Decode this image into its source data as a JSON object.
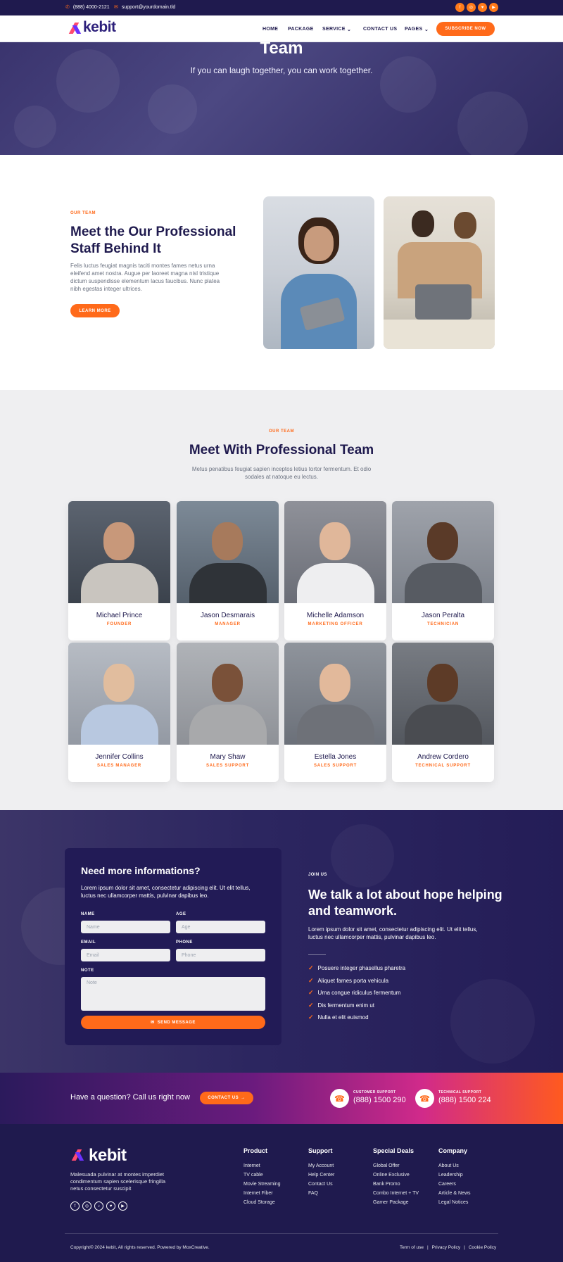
{
  "topbar": {
    "phone": "(888) 4000-2121",
    "email": "support@yourdomain.tld",
    "social": [
      "f",
      "◎",
      "♥",
      "▶"
    ]
  },
  "brand": {
    "name": "kebit",
    "accent": "#ff6a1a",
    "dark": "#1f1a4e"
  },
  "nav": {
    "items": [
      "HOME",
      "PACKAGE",
      "SERVICE",
      "CONTACT US",
      "PAGES"
    ],
    "cta": "SUBSCRIBE NOW"
  },
  "hero": {
    "title": "Team",
    "subtitle": "If you can laugh together, you can work together."
  },
  "meet": {
    "kicker": "OUR TEAM",
    "title_line1": "Meet the Our Professional",
    "title_line2": "Staff Behind It",
    "body": "Felis luctus feugiat magnis taciti montes fames netus urna eleifend amet nostra. Augue per laoreet magna nisl tristique dictum suspendisse elementum lacus faucibus. Nunc platea nibh egestas integer ultrices.",
    "button": "LEARN MORE"
  },
  "team": {
    "kicker": "OUR TEAM",
    "title": "Meet With Professional Team",
    "intro_line1": "Metus penatibus feugiat sapien inceptos letius tortor fermentum. Et odio",
    "intro_line2": "sodales at natoque eu lectus.",
    "members": [
      {
        "name": "Michael Prince",
        "role": "FOUNDER"
      },
      {
        "name": "Jason Desmarais",
        "role": "MANAGER"
      },
      {
        "name": "Michelle Adamson",
        "role": "MARKETING OFFICER"
      },
      {
        "name": "Jason Peralta",
        "role": "TECHNICIAN"
      },
      {
        "name": "Jennifer Collins",
        "role": "SALES MANAGER"
      },
      {
        "name": "Mary Shaw",
        "role": "SALES SUPPORT"
      },
      {
        "name": "Estella Jones",
        "role": "SALES SUPPORT"
      },
      {
        "name": "Andrew Cordero",
        "role": "TECHNICAL SUPPORT"
      }
    ]
  },
  "form": {
    "title": "Need more informations?",
    "intro_line1": "Lorem ipsum dolor sit amet, consectetur adipiscing elit. Ut elit tellus,",
    "intro_line2": "luctus nec ullamcorper mattis, pulvinar dapibus leo.",
    "name_label": "NAME",
    "name_placeholder": "Name",
    "age_label": "AGE",
    "age_placeholder": "Age",
    "email_label": "EMAIL",
    "email_placeholder": "Email",
    "phone_label": "PHONE",
    "phone_placeholder": "Phone",
    "note_label": "NOTE",
    "note_placeholder": "Note",
    "submit": "SEND MESSAGE"
  },
  "join": {
    "kicker": "JOIN US",
    "title_line1": "We talk a lot about hope helping",
    "title_line2": "and teamwork.",
    "body_line1": "Lorem ipsum dolor sit amet, consectetur adipiscing elit. Ut elit tellus,",
    "body_line2": "luctus nec ullamcorper mattis, pulvinar dapibus leo.",
    "list": [
      "Posuere integer phasellus pharetra",
      "Aliquet fames porta vehicula",
      "Urna congue ridiculus fermentum",
      "Dis fermentum enim ut",
      "Nulla et elit euismod"
    ]
  },
  "cta": {
    "question": "Have a question? Call us right now",
    "button": "CONTACT US",
    "customer_label": "CUSTOMER SUPPORT",
    "customer_phone": "(888) 1500 290",
    "tech_label": "TECHNICAL SUPPORT",
    "tech_phone": "(888) 1500 224"
  },
  "footer": {
    "about_line1": "Malesuada pulvinar at montes imperdiet",
    "about_line2": "condimentum sapien scelerisque fringilla",
    "about_line3": "netus consectetur suscipit",
    "social": [
      "f",
      "◎",
      "♪",
      "♥",
      "▶"
    ],
    "columns": [
      {
        "title": "Product",
        "links": [
          "Internet",
          "TV cable",
          "Movie Streaming",
          "Internet Fiber",
          "Cloud Storage"
        ]
      },
      {
        "title": "Support",
        "links": [
          "My Account",
          "Help Center",
          "Contact Us",
          "FAQ"
        ]
      },
      {
        "title": "Special Deals",
        "links": [
          "Global Offer",
          "Online Exclusive",
          "Bank Promo",
          "Combo Internet + TV",
          "Gamer Package"
        ]
      },
      {
        "title": "Company",
        "links": [
          "About Us",
          "Leadership",
          "Careers",
          "Article & News",
          "Legal Notices"
        ]
      }
    ],
    "copyright": "Copyright© 2024 kebit, All rights reserved. Powered by MoxCreative.",
    "legal": [
      "Term of use",
      "Privacy Policy",
      "Cookie Policy"
    ]
  }
}
